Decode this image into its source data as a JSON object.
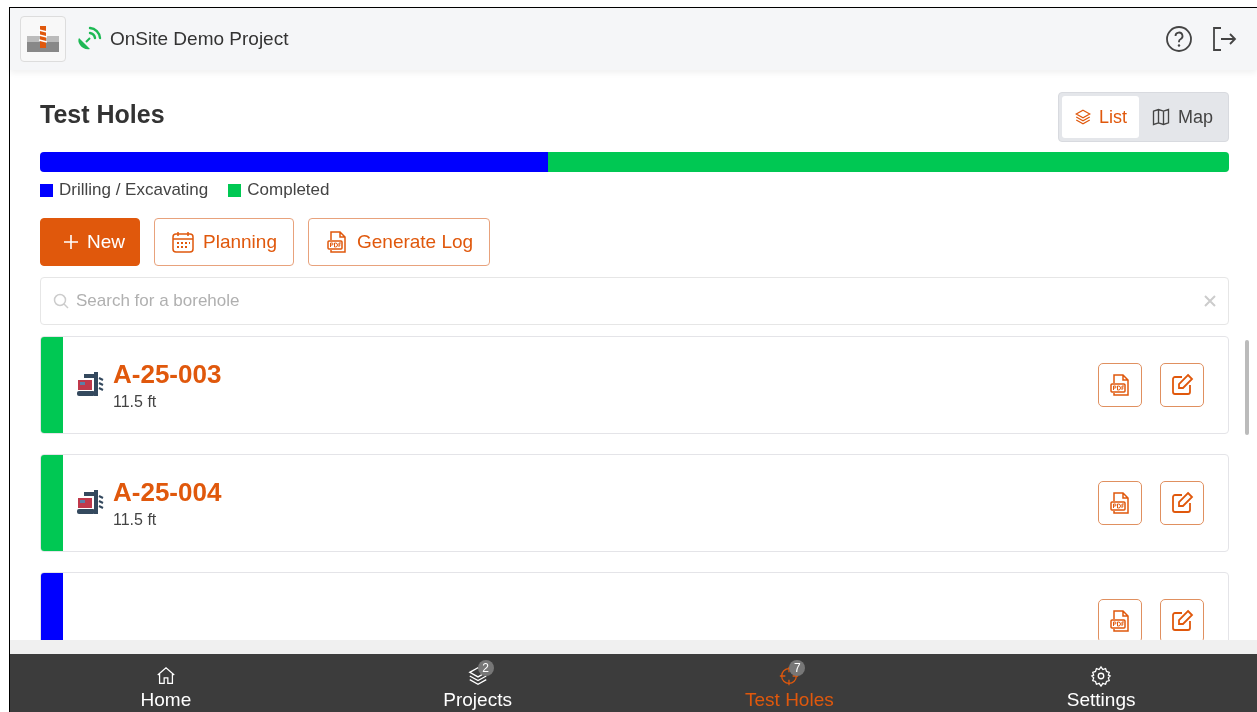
{
  "header": {
    "title": "OnSite Demo Project"
  },
  "page": {
    "title": "Test Holes"
  },
  "view_toggle": [
    {
      "label": "List",
      "selected": true
    },
    {
      "label": "Map",
      "selected": false
    }
  ],
  "progress": [
    {
      "label": "Drilling / Excavating",
      "color": "#0000ff",
      "level": 0.427
    },
    {
      "label": "Completed",
      "color": "#00c853",
      "level": 0.573
    }
  ],
  "actions": [
    {
      "kind": "primary",
      "label": "New"
    },
    {
      "kind": "calendar",
      "label": "Planning"
    },
    {
      "kind": "pdf",
      "label": "Generate Log"
    }
  ],
  "search": {
    "placeholder": "Search for a borehole"
  },
  "holes": [
    {
      "name": "A-25-003",
      "depth": "11.5 ft",
      "color": "#00c853"
    },
    {
      "name": "A-25-004",
      "depth": "11.5 ft",
      "color": "#00c853"
    },
    {
      "color": "#0000ff"
    }
  ],
  "nav": [
    {
      "kind": "home",
      "label": "Home",
      "selected": false
    },
    {
      "kind": "layers",
      "label": "Projects",
      "badge": "2",
      "selected": false
    },
    {
      "kind": "target",
      "label": "Test Holes",
      "badge": "7",
      "selected": true
    },
    {
      "kind": "gear",
      "label": "Settings",
      "selected": false
    }
  ]
}
